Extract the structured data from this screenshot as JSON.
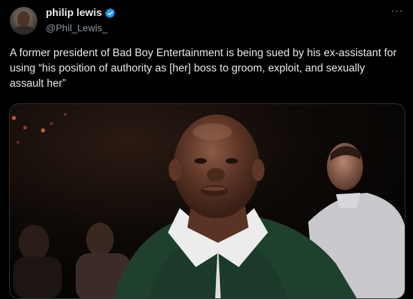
{
  "author": {
    "display_name": "philip lewis",
    "handle": "@Phil_Lewis_",
    "verified": true,
    "avatar_icon": "avatar-photo"
  },
  "more_label": "···",
  "tweet": {
    "text": "A former president of Bad Boy Entertainment is being sued by his ex-assistant for using “his position of authority as [her] boss to groom, exploit, and sexually assault her”"
  },
  "media": {
    "kind": "photo"
  },
  "colors": {
    "background": "#000000",
    "text": "#e7e9ea",
    "secondary": "#8b98a5",
    "verified_blue": "#1d9bf0",
    "border": "#2f3336"
  }
}
